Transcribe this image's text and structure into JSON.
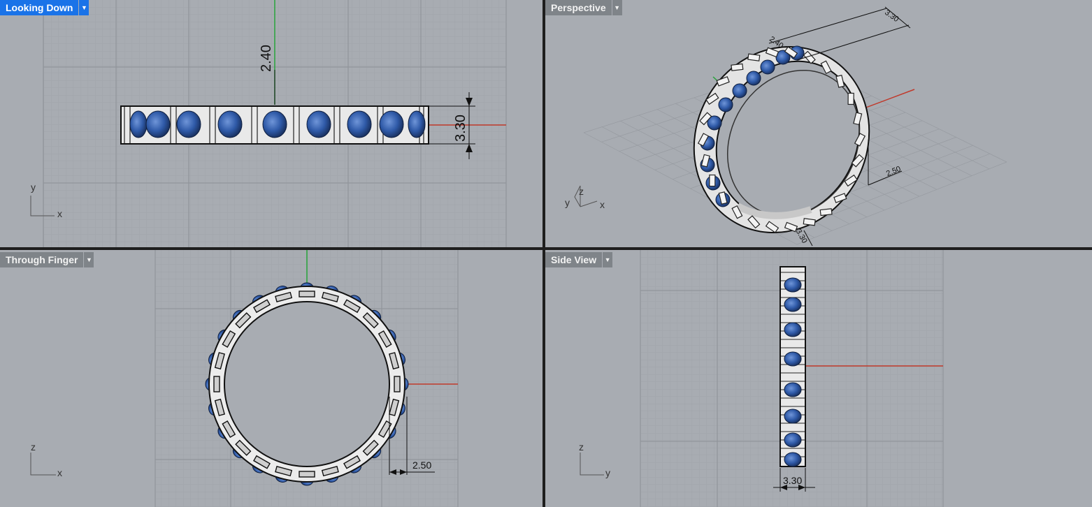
{
  "viewports": {
    "top_left": {
      "name": "Looking Down",
      "active": true,
      "axes": [
        "y",
        "x"
      ],
      "dims": [
        "2.40",
        "3.30"
      ]
    },
    "top_right": {
      "name": "Perspective",
      "active": false,
      "axes": [
        "z",
        "y",
        "x"
      ],
      "dims": [
        "3.30",
        "2.40",
        "2.50",
        "3.30"
      ]
    },
    "bottom_left": {
      "name": "Through Finger",
      "active": false,
      "axes": [
        "z",
        "x"
      ],
      "dims": [
        "2.50"
      ]
    },
    "bottom_right": {
      "name": "Side View",
      "active": false,
      "axes": [
        "z",
        "y"
      ],
      "dims": [
        "3.30"
      ]
    }
  },
  "icons": {
    "viewport_menu": "chevron-down-icon"
  },
  "colors": {
    "x_axis": "#c0392b",
    "y_axis": "#27a43a",
    "gem": "#2f5aa8",
    "active_tab": "#1a73e8",
    "viewport_bg": "#a8acb2"
  }
}
